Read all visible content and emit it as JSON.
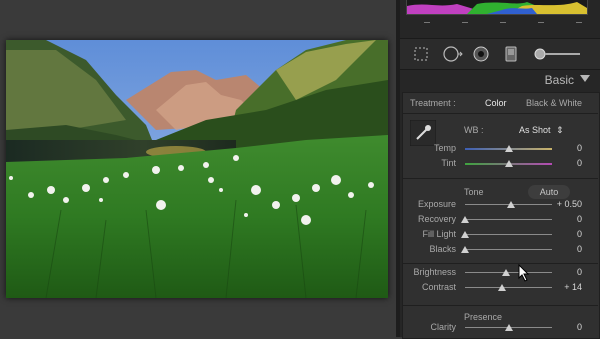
{
  "panel": {
    "title": "Basic",
    "treatment_label": "Treatment :",
    "treatment_color": "Color",
    "treatment_bw": "Black & White",
    "wb_label": "WB :",
    "wb_value": "As Shot",
    "sections": {
      "tone": "Tone",
      "presence": "Presence"
    },
    "auto_label": "Auto",
    "sliders": [
      {
        "label": "Temp",
        "value": "0",
        "level": 0.5
      },
      {
        "label": "Tint",
        "value": "0",
        "level": 0.5
      },
      {
        "label": "Exposure",
        "value": "+ 0.50",
        "level": 0.53
      },
      {
        "label": "Recovery",
        "value": "0",
        "level": 0.0
      },
      {
        "label": "Fill Light",
        "value": "0",
        "level": 0.0
      },
      {
        "label": "Blacks",
        "value": "0",
        "level": 0.0
      },
      {
        "label": "Brightness",
        "value": "0",
        "level": 0.47
      },
      {
        "label": "Contrast",
        "value": "+ 14",
        "level": 0.43
      },
      {
        "label": "Clarity",
        "value": "0",
        "level": 0.5
      }
    ]
  },
  "histogram": {
    "ticks": 5
  },
  "icons": {
    "crop": "crop-icon",
    "spot": "spot-removal-icon",
    "redeye": "red-eye-icon",
    "gradient": "graduated-filter-icon",
    "brush": "adjustment-brush-icon",
    "eyedropper": "eyedropper-icon",
    "cursor": "mouse-cursor-icon"
  }
}
